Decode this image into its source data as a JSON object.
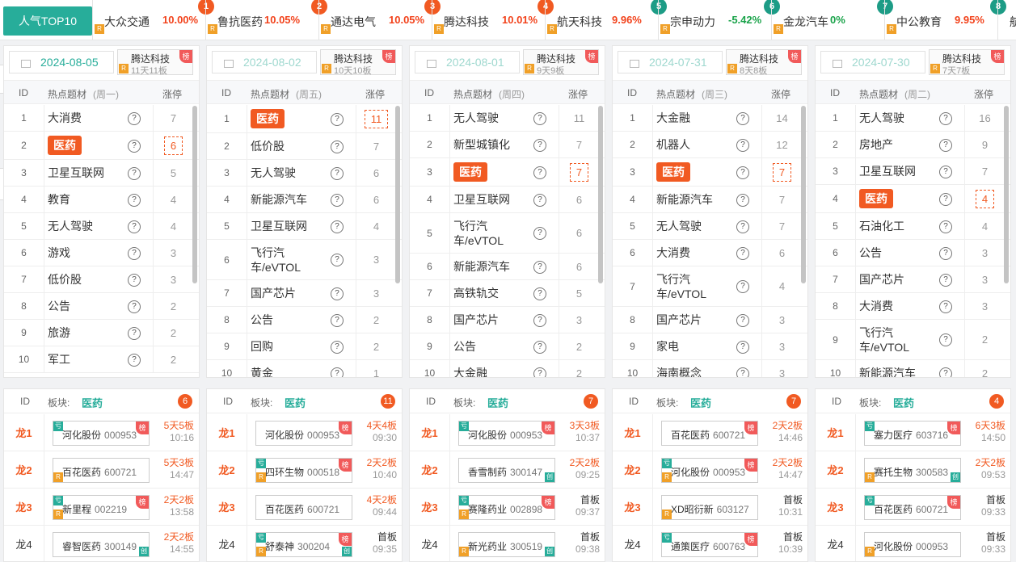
{
  "top": {
    "tab": "人气TOP10",
    "items": [
      {
        "rank": "1",
        "name": "大众交通",
        "pct": "10.00%",
        "dir": "up"
      },
      {
        "rank": "2",
        "name": "鲁抗医药",
        "pct": "10.05%",
        "dir": "up"
      },
      {
        "rank": "3",
        "name": "通达电气",
        "pct": "10.05%",
        "dir": "up"
      },
      {
        "rank": "4",
        "name": "腾达科技",
        "pct": "10.01%",
        "dir": "up"
      },
      {
        "rank": "5",
        "name": "航天科技",
        "pct": "9.96%",
        "dir": "up"
      },
      {
        "rank": "6",
        "name": "宗申动力",
        "pct": "-5.42%",
        "dir": "dn"
      },
      {
        "rank": "7",
        "name": "金龙汽车",
        "pct": "0%",
        "dir": "dn"
      },
      {
        "rank": "8",
        "name": "中公教育",
        "pct": "9.95%",
        "dir": "up"
      },
      {
        "rank": "",
        "name": "航",
        "pct": "",
        "dir": "up"
      }
    ]
  },
  "labels": {
    "id": "ID",
    "topic": "热点题材",
    "limit": "涨停",
    "board": "板块:",
    "rank_badge": "榜",
    "r": "R",
    "hong": "亏",
    "chuang": "创",
    "q": "?"
  },
  "columns": [
    {
      "date": "2024-08-05",
      "weekday": "(周一)",
      "stock": "腾达科技",
      "streak": "11天11板",
      "rows": [
        [
          "1",
          "大消费",
          "7"
        ],
        [
          "2",
          "医药",
          "6"
        ],
        [
          "3",
          "卫星互联网",
          "5"
        ],
        [
          "4",
          "教育",
          "4"
        ],
        [
          "5",
          "无人驾驶",
          "4"
        ],
        [
          "6",
          "游戏",
          "3"
        ],
        [
          "7",
          "低价股",
          "3"
        ],
        [
          "8",
          "公告",
          "2"
        ],
        [
          "9",
          "旅游",
          "2"
        ],
        [
          "10",
          "军工",
          "2"
        ]
      ],
      "sector": "医药",
      "count": "6",
      "leaders": [
        {
          "lg": "龙1",
          "name": "河化股份",
          "code": "000953",
          "s1": "5天5板",
          "s2": "10:16"
        },
        {
          "lg": "龙2",
          "name": "百花医药",
          "code": "600721",
          "s1": "5天3板",
          "s2": "14:47"
        },
        {
          "lg": "龙3",
          "name": "新里程",
          "code": "002219",
          "s1": "2天2板",
          "s2": "13:58"
        },
        {
          "lg": "龙4",
          "name": "睿智医药",
          "code": "300149",
          "s1": "2天2板",
          "s2": "14:55"
        }
      ]
    },
    {
      "date": "2024-08-02",
      "weekday": "(周五)",
      "stock": "腾达科技",
      "streak": "10天10板",
      "rows": [
        [
          "1",
          "医药",
          "11"
        ],
        [
          "2",
          "低价股",
          "7"
        ],
        [
          "3",
          "无人驾驶",
          "6"
        ],
        [
          "4",
          "新能源汽车",
          "6"
        ],
        [
          "5",
          "卫星互联网",
          "4"
        ],
        [
          "6",
          "飞行汽车/eVTOL",
          "3"
        ],
        [
          "7",
          "国产芯片",
          "3"
        ],
        [
          "8",
          "公告",
          "2"
        ],
        [
          "9",
          "回购",
          "2"
        ],
        [
          "10",
          "黄金",
          "1"
        ]
      ],
      "sector": "医药",
      "count": "11",
      "leaders": [
        {
          "lg": "龙1",
          "name": "河化股份",
          "code": "000953",
          "s1": "4天4板",
          "s2": "09:30"
        },
        {
          "lg": "龙2",
          "name": "四环生物",
          "code": "000518",
          "s1": "2天2板",
          "s2": "10:40"
        },
        {
          "lg": "龙3",
          "name": "百花医药",
          "code": "600721",
          "s1": "4天2板",
          "s2": "09:44"
        },
        {
          "lg": "龙4",
          "name": "舒泰神",
          "code": "300204",
          "s1": "首板",
          "s2": "09:35"
        }
      ]
    },
    {
      "date": "2024-08-01",
      "weekday": "(周四)",
      "stock": "腾达科技",
      "streak": "9天9板",
      "rows": [
        [
          "1",
          "无人驾驶",
          "11"
        ],
        [
          "2",
          "新型城镇化",
          "7"
        ],
        [
          "3",
          "医药",
          "7"
        ],
        [
          "4",
          "卫星互联网",
          "6"
        ],
        [
          "5",
          "飞行汽车/eVTOL",
          "6"
        ],
        [
          "6",
          "新能源汽车",
          "6"
        ],
        [
          "7",
          "高铁轨交",
          "5"
        ],
        [
          "8",
          "国产芯片",
          "3"
        ],
        [
          "9",
          "公告",
          "2"
        ],
        [
          "10",
          "大金融",
          "2"
        ]
      ],
      "sector": "医药",
      "count": "7",
      "leaders": [
        {
          "lg": "龙1",
          "name": "河化股份",
          "code": "000953",
          "s1": "3天3板",
          "s2": "10:37"
        },
        {
          "lg": "龙2",
          "name": "香雪制药",
          "code": "300147",
          "s1": "2天2板",
          "s2": "09:25"
        },
        {
          "lg": "龙3",
          "name": "赛隆药业",
          "code": "002898",
          "s1": "首板",
          "s2": "09:37"
        },
        {
          "lg": "龙4",
          "name": "新光药业",
          "code": "300519",
          "s1": "首板",
          "s2": "09:38"
        }
      ]
    },
    {
      "date": "2024-07-31",
      "weekday": "(周三)",
      "stock": "腾达科技",
      "streak": "8天8板",
      "rows": [
        [
          "1",
          "大金融",
          "14"
        ],
        [
          "2",
          "机器人",
          "12"
        ],
        [
          "3",
          "医药",
          "7"
        ],
        [
          "4",
          "新能源汽车",
          "7"
        ],
        [
          "5",
          "无人驾驶",
          "7"
        ],
        [
          "6",
          "大消费",
          "6"
        ],
        [
          "7",
          "飞行汽车/eVTOL",
          "4"
        ],
        [
          "8",
          "国产芯片",
          "3"
        ],
        [
          "9",
          "家电",
          "3"
        ],
        [
          "10",
          "海南概念",
          "3"
        ]
      ],
      "sector": "医药",
      "count": "7",
      "leaders": [
        {
          "lg": "龙1",
          "name": "百花医药",
          "code": "600721",
          "s1": "2天2板",
          "s2": "14:46"
        },
        {
          "lg": "龙2",
          "name": "河化股份",
          "code": "000953",
          "s1": "2天2板",
          "s2": "14:47"
        },
        {
          "lg": "龙3",
          "name": "XD昭衍新",
          "code": "603127",
          "s1": "首板",
          "s2": "10:31"
        },
        {
          "lg": "龙4",
          "name": "通策医疗",
          "code": "600763",
          "s1": "首板",
          "s2": "10:39"
        }
      ]
    },
    {
      "date": "2024-07-30",
      "weekday": "(周二)",
      "stock": "腾达科技",
      "streak": "7天7板",
      "rows": [
        [
          "1",
          "无人驾驶",
          "16"
        ],
        [
          "2",
          "房地产",
          "9"
        ],
        [
          "3",
          "卫星互联网",
          "7"
        ],
        [
          "4",
          "医药",
          "4"
        ],
        [
          "5",
          "石油化工",
          "4"
        ],
        [
          "6",
          "公告",
          "3"
        ],
        [
          "7",
          "国产芯片",
          "3"
        ],
        [
          "8",
          "大消费",
          "3"
        ],
        [
          "9",
          "飞行汽车/eVTOL",
          "2"
        ],
        [
          "10",
          "新能源汽车",
          "2"
        ]
      ],
      "sector": "医药",
      "count": "4",
      "leaders": [
        {
          "lg": "龙1",
          "name": "塞力医疗",
          "code": "603716",
          "s1": "6天3板",
          "s2": "14:50"
        },
        {
          "lg": "龙2",
          "name": "赛托生物",
          "code": "300583",
          "s1": "2天2板",
          "s2": "09:53"
        },
        {
          "lg": "龙3",
          "name": "百花医药",
          "code": "600721",
          "s1": "首板",
          "s2": "09:33"
        },
        {
          "lg": "龙4",
          "name": "河化股份",
          "code": "000953",
          "s1": "首板",
          "s2": "09:33"
        }
      ]
    }
  ],
  "colors": {
    "accent": "#27ad9a",
    "hot": "#f15a22",
    "up": "#f2421b",
    "down": "#1aa34a"
  }
}
